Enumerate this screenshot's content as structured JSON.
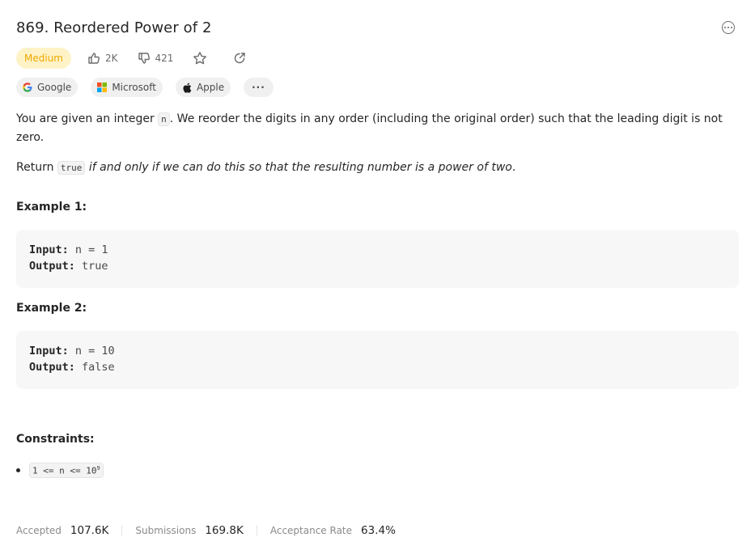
{
  "problem": {
    "title": "869. Reordered Power of 2",
    "difficulty": "Medium",
    "likes": "2K",
    "dislikes": "421"
  },
  "tags": [
    {
      "name": "Google",
      "icon": "google-logo"
    },
    {
      "name": "Microsoft",
      "icon": "microsoft-logo"
    },
    {
      "name": "Apple",
      "icon": "apple-logo"
    },
    {
      "name": "···",
      "icon": "more-dots"
    }
  ],
  "description": {
    "p1_before": "You are given an integer ",
    "p1_code": "n",
    "p1_after": ". We reorder the digits in any order (including the original order) such that the leading digit is not zero.",
    "p2_before": "Return ",
    "p2_code": "true",
    "p2_after": " if and only if we can do this so that the resulting number is a power of two",
    "p2_end": "."
  },
  "examples": [
    {
      "title": "Example 1:",
      "input_label": "Input:",
      "input": "n = 1",
      "output_label": "Output:",
      "output": "true"
    },
    {
      "title": "Example 2:",
      "input_label": "Input:",
      "input": "n = 10",
      "output_label": "Output:",
      "output": "false"
    }
  ],
  "constraints": {
    "title": "Constraints:",
    "item_base": "1 <= n <= 10",
    "item_sup": "9"
  },
  "stats": {
    "accepted_label": "Accepted",
    "accepted_value": "107.6K",
    "submissions_label": "Submissions",
    "submissions_value": "169.8K",
    "rate_label": "Acceptance Rate",
    "rate_value": "63.4%"
  },
  "colors": {
    "difficulty_bg": "#fef3c7",
    "difficulty_text": "#f0a800",
    "code_bg": "#f7f7f8"
  }
}
